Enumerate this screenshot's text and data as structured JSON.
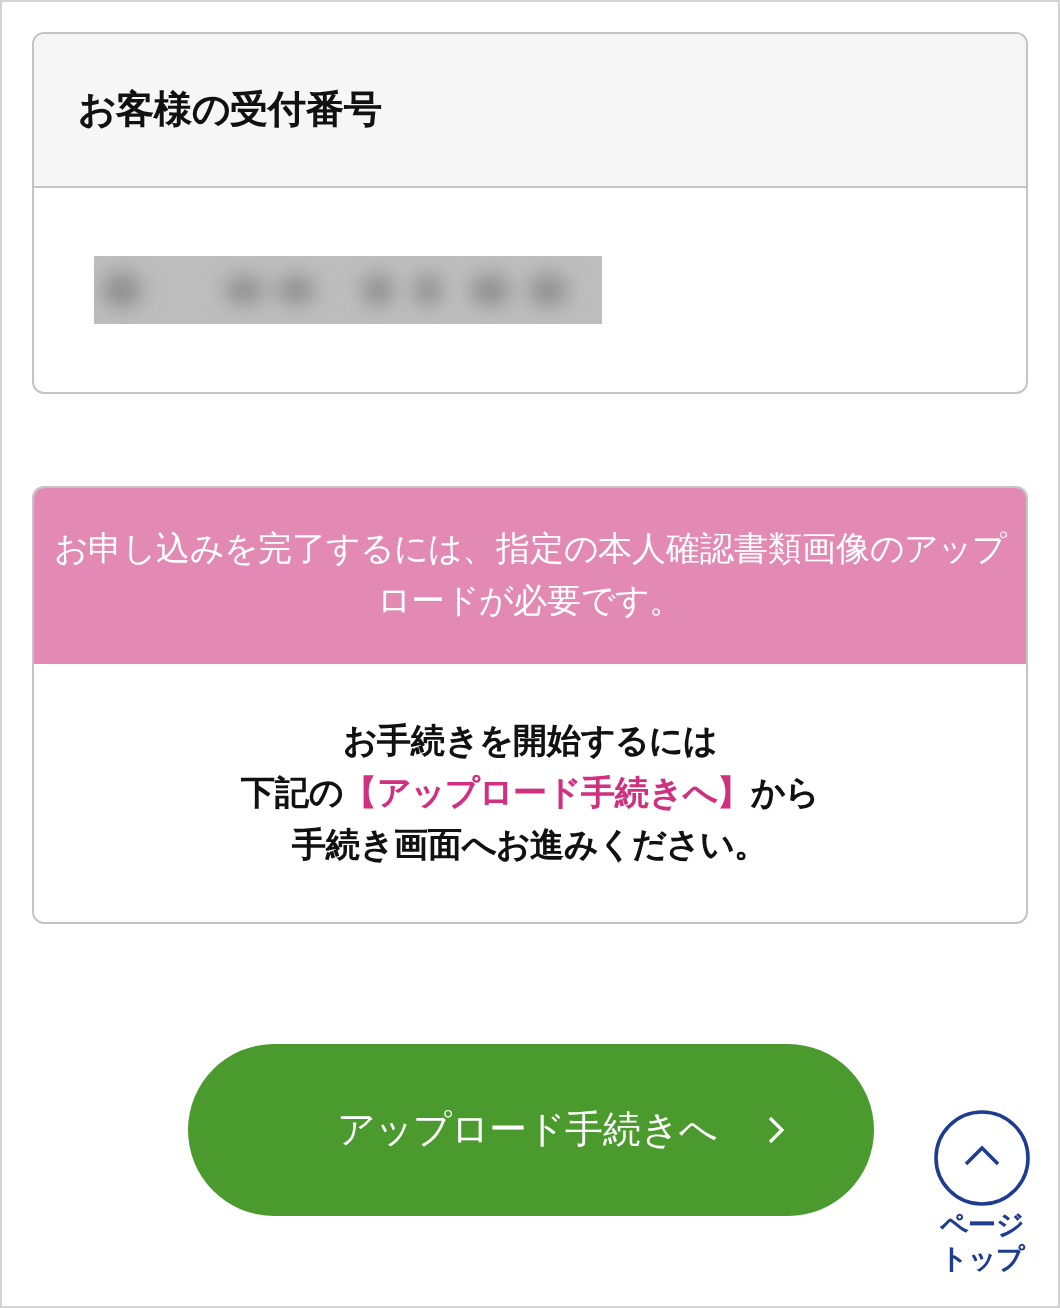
{
  "receipt_card": {
    "title": "お客様の受付番号"
  },
  "notice": {
    "banner": "お申し込みを完了するには、指定の本人確認書類画像のアップロードが必要です。",
    "instructions": [
      {
        "before": "お手続きを開始するには"
      },
      {
        "before": "下記の",
        "highlight": "【アップロード手続きへ】",
        "after": "から"
      },
      {
        "before": "手続き画面へお進みください。"
      }
    ]
  },
  "upload_button": {
    "label": "アップロード手続きへ"
  },
  "page_top": {
    "label": "ページトップ"
  }
}
